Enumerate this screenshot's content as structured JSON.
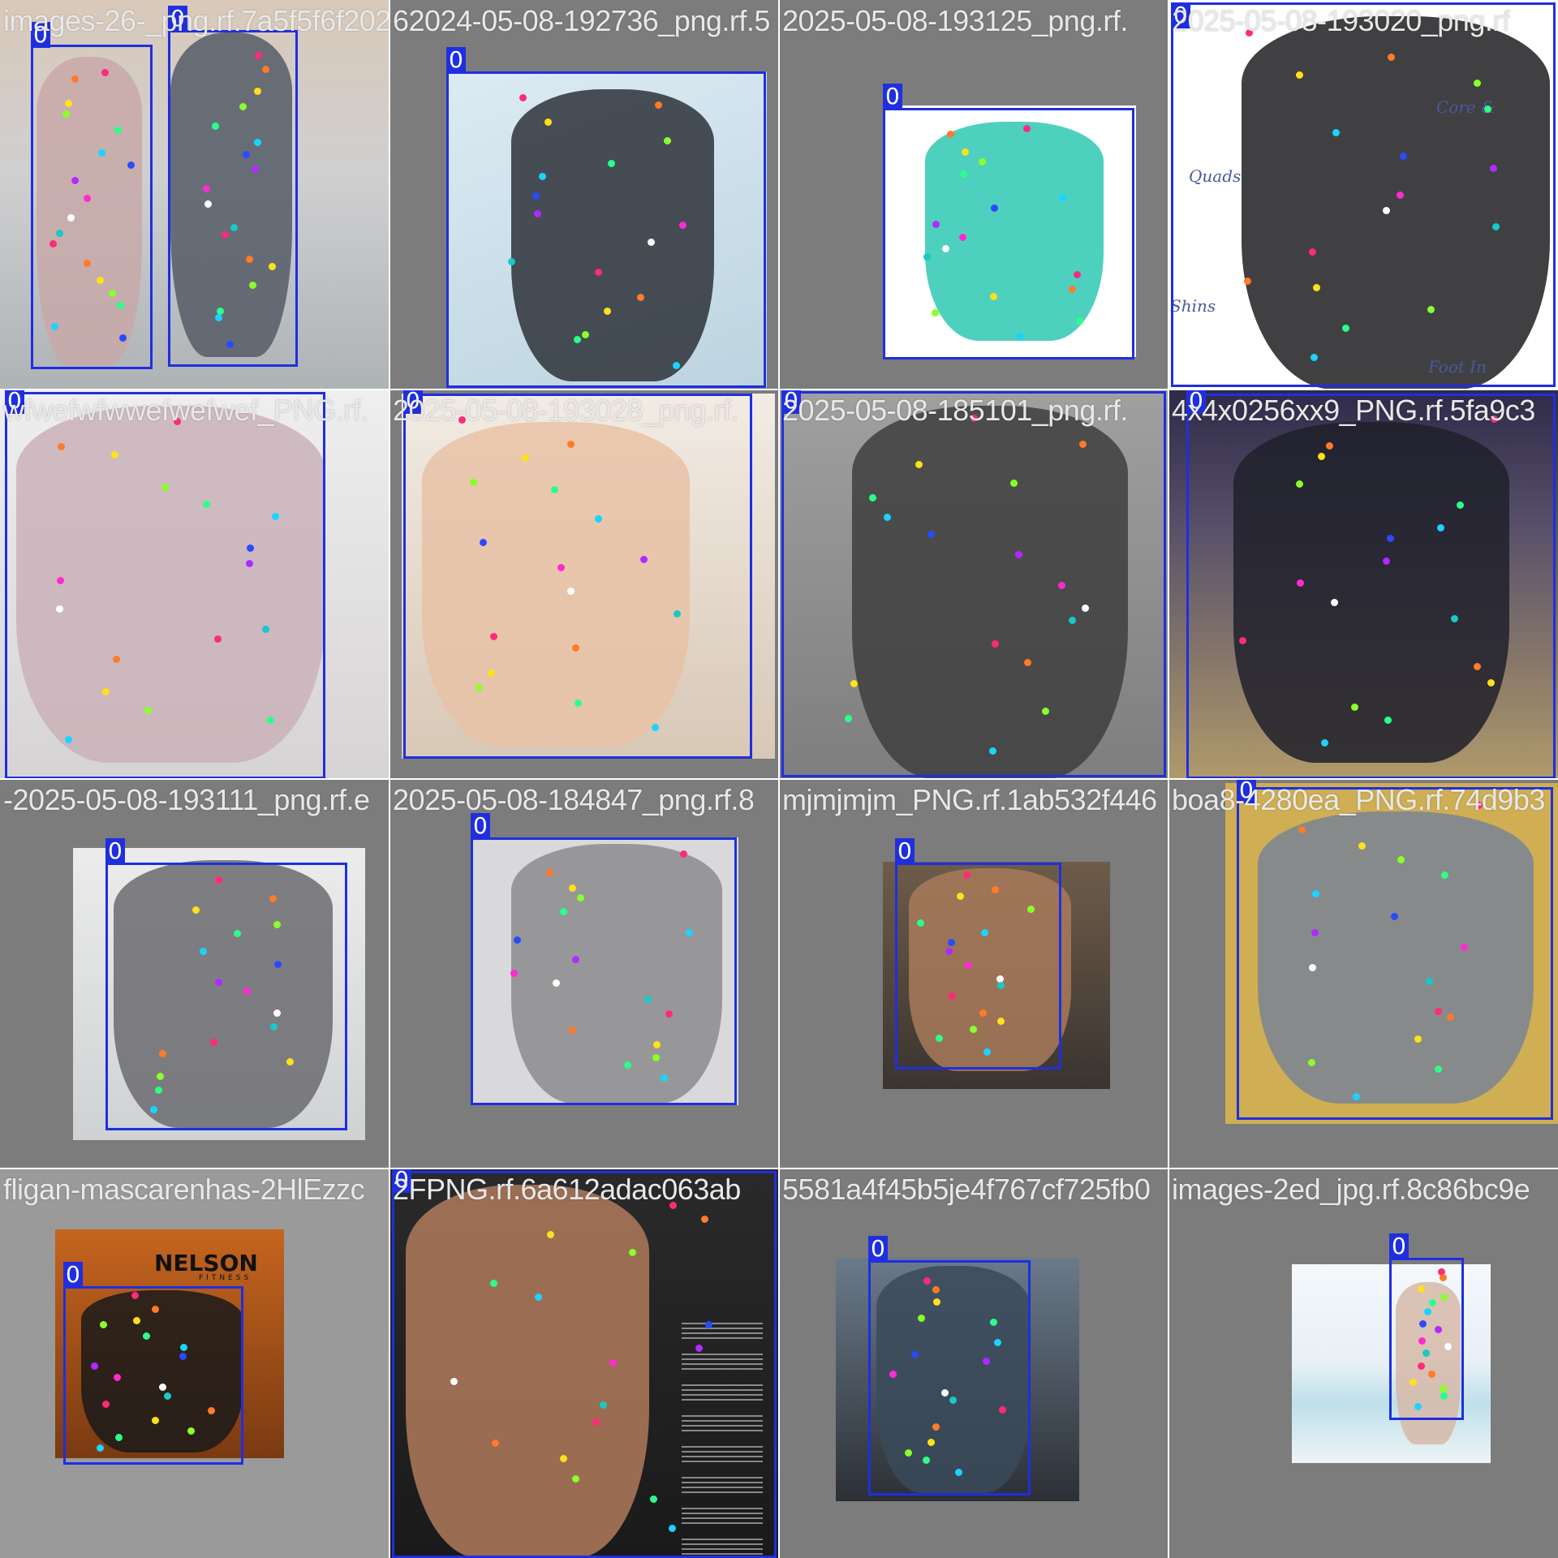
{
  "colors": {
    "box": "#1f2fe0",
    "label_text": "#e8e8e8",
    "keypoints": [
      "#ff2a7a",
      "#ff7a2a",
      "#ffe11a",
      "#8aff2a",
      "#2aff8a",
      "#1ad4ff",
      "#2a4aff",
      "#b02aff",
      "#ff2ad4",
      "#ffffff",
      "#19c8c8"
    ]
  },
  "class_label": "0",
  "tiles": [
    {
      "filename": "images-26-_png.rf.7a5f5f6f2024-05-08-192736_png.rf.5",
      "boxes": 2
    },
    {
      "filename": "62024-05-08-192736_png.rf.5",
      "boxes": 1
    },
    {
      "filename": "2025-05-08-193125_png.rf.",
      "boxes": 1
    },
    {
      "filename": "2025-05-08-193020_png.rf",
      "boxes": 1,
      "annotations": [
        "Core &",
        "Quads",
        "Shins",
        "Foot In"
      ]
    },
    {
      "filename": "wfwefwfwwefwefwef_PNG.rf.",
      "boxes": 1
    },
    {
      "filename": "2025-05-08-193028_png.rf.",
      "boxes": 1
    },
    {
      "filename": "2025-05-08-185101_png.rf.",
      "boxes": 1
    },
    {
      "filename": "4x4x0256xx9_PNG.rf.5fa9c3",
      "boxes": 1
    },
    {
      "filename": "-2025-05-08-193111_png.rf.e",
      "boxes": 1
    },
    {
      "filename": "2025-05-08-184847_png.rf.8",
      "boxes": 1
    },
    {
      "filename": "mjmjmjm_PNG.rf.1ab532f446",
      "boxes": 1
    },
    {
      "filename": "boa8-4280ea_PNG.rf.74d9b3",
      "boxes": 1
    },
    {
      "filename": "fligan-mascarenhas-2HlEzzc",
      "boxes": 1,
      "logo": "NELSON",
      "logo_sub": "FITNESS"
    },
    {
      "filename": "2FPNG.rf.6a612adac063ab",
      "boxes": 1
    },
    {
      "filename": "5581a4f45b5je4f767cf725fb0",
      "boxes": 1
    },
    {
      "filename": "images-2ed_jpg.rf.8c86bc9e",
      "boxes": 1
    }
  ]
}
